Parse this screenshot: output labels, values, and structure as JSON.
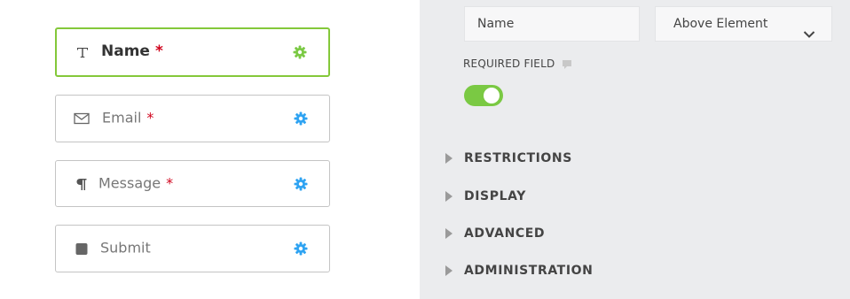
{
  "fields": [
    {
      "label": "Name",
      "required_mark": "*",
      "icon": "text-t-icon",
      "active": true
    },
    {
      "label": "Email",
      "required_mark": "*",
      "icon": "envelope-icon",
      "active": false
    },
    {
      "label": "Message",
      "required_mark": "*",
      "icon": "paragraph-icon",
      "active": false
    },
    {
      "label": "Submit",
      "required_mark": "",
      "icon": "square-icon",
      "active": false
    }
  ],
  "settings": {
    "label_value": "Name",
    "label_position": "Above Element",
    "required_field_label": "REQUIRED FIELD",
    "required_on": true
  },
  "sections": [
    {
      "title": "RESTRICTIONS"
    },
    {
      "title": "DISPLAY"
    },
    {
      "title": "ADVANCED"
    },
    {
      "title": "ADMINISTRATION"
    }
  ],
  "colors": {
    "active_border": "#84c83a",
    "gear_active": "#7ac943",
    "gear_default": "#2ea3f2",
    "required": "#d0021b",
    "toggle_on": "#7ac943"
  }
}
